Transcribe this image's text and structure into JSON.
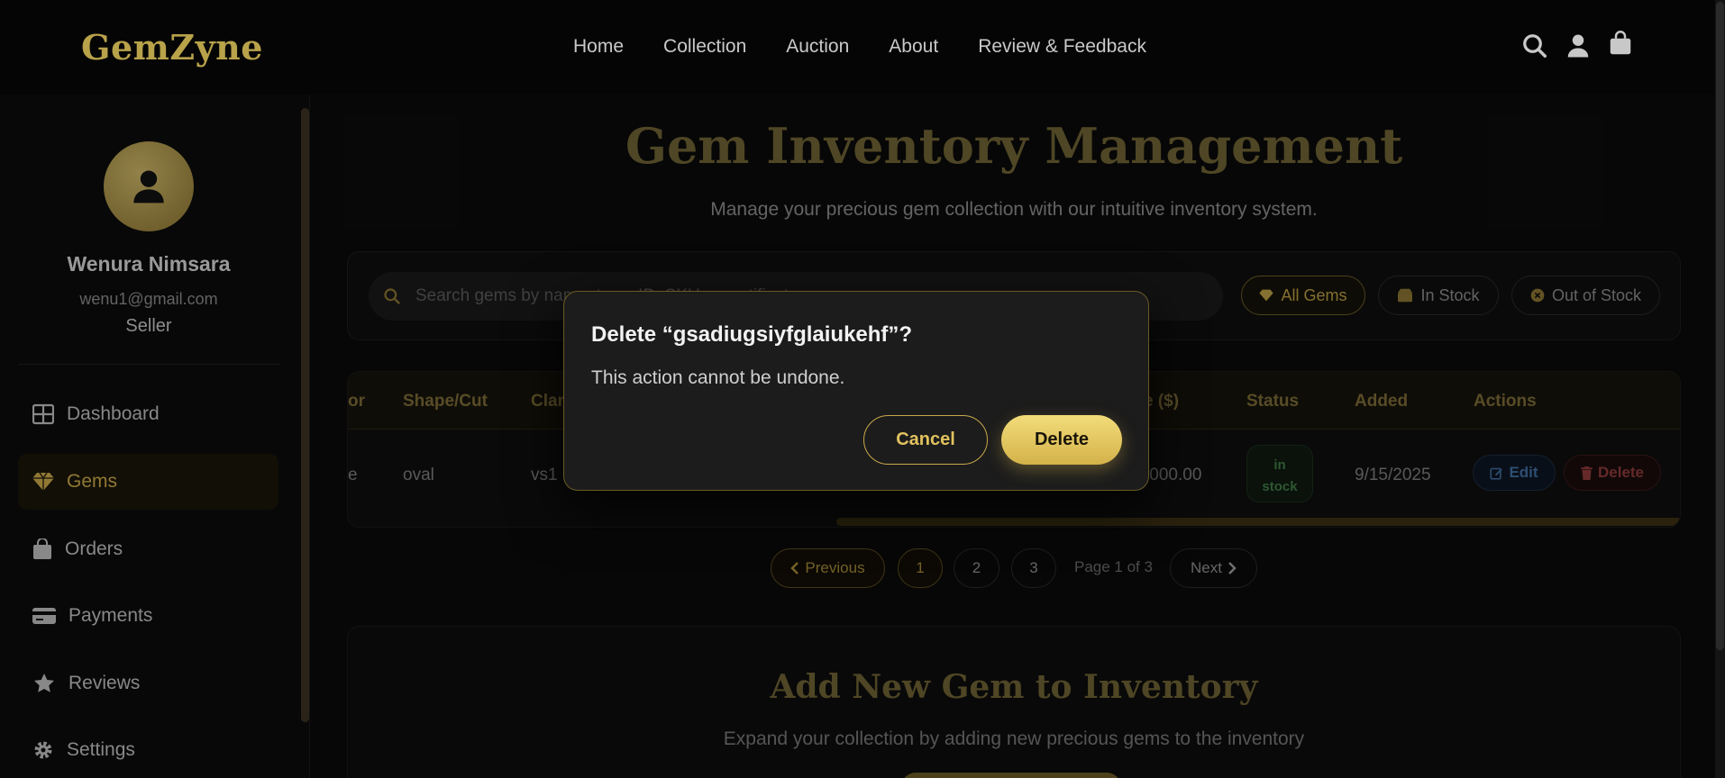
{
  "brand": "GemZyne",
  "nav": [
    "Home",
    "Collection",
    "Auction",
    "About",
    "Review & Feedback"
  ],
  "header_icons": [
    "search-icon",
    "user-icon",
    "shopping-bag-icon"
  ],
  "user": {
    "name": "Wenura Nimsara",
    "email": "wenu1@gmail.com",
    "role": "Seller"
  },
  "sidebar": {
    "items": [
      {
        "label": "Dashboard",
        "icon": "dashboard-icon"
      },
      {
        "label": "Gems",
        "icon": "gem-icon",
        "active": true
      },
      {
        "label": "Orders",
        "icon": "bag-icon"
      },
      {
        "label": "Payments",
        "icon": "credit-card-icon"
      },
      {
        "label": "Reviews",
        "icon": "star-icon"
      },
      {
        "label": "Settings",
        "icon": "gear-icon"
      }
    ]
  },
  "main": {
    "title": "Gem Inventory Management",
    "subtitle": "Manage your precious gem collection with our intuitive inventory system."
  },
  "search": {
    "placeholder": "Search gems by name, type, ID, SKU or certificate"
  },
  "filters": [
    "All Gems",
    "In Stock",
    "Out of Stock"
  ],
  "table": {
    "headers": [
      "or",
      "Shape/Cut",
      "Clar",
      "e ($)",
      "Status",
      "Added",
      "Actions"
    ],
    "row": {
      "c0": "e",
      "shape": "oval",
      "clarity": "vs1",
      "price": ",000.00",
      "status_line1": "in",
      "status_line2": "stock",
      "added": "9/15/2025",
      "edit": "Edit",
      "delete": "Delete"
    }
  },
  "pagination": {
    "previous": "Previous",
    "pages": [
      "1",
      "2",
      "3"
    ],
    "info": "Page 1 of 3",
    "next": "Next"
  },
  "add_section": {
    "title": "Add New Gem to Inventory",
    "subtitle": "Expand your collection by adding new precious gems to the inventory"
  },
  "modal": {
    "title": "Delete “gsadiugsiyfglaiukehf”?",
    "message": "This action cannot be undone.",
    "cancel": "Cancel",
    "confirm": "Delete"
  },
  "colors": {
    "accent": "#c9a84a",
    "background": "#0b0b0b",
    "modal_bg": "#1c1c1c"
  }
}
